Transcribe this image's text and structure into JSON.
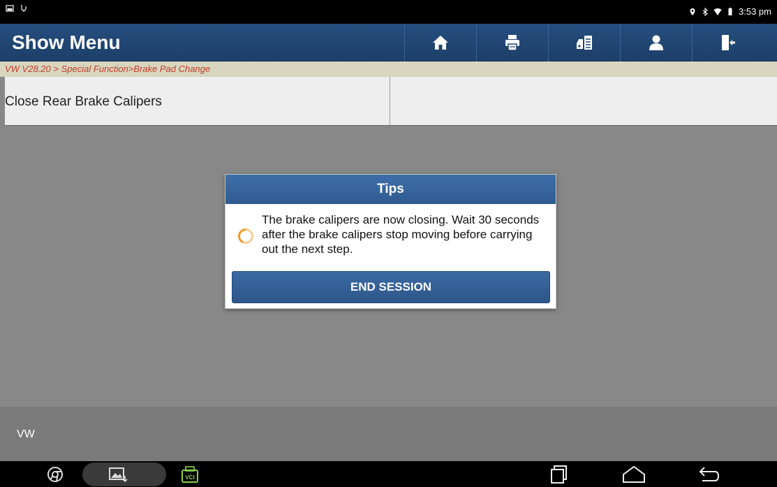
{
  "status_bar": {
    "time": "3:53 pm"
  },
  "header": {
    "title": "Show Menu",
    "toolbar": [
      {
        "icon": "home-icon"
      },
      {
        "icon": "print-icon"
      },
      {
        "icon": "vehicle-info-icon"
      },
      {
        "icon": "user-icon"
      },
      {
        "icon": "exit-icon"
      }
    ]
  },
  "breadcrumb": "VW V28.20 > Special Function>Brake Pad Change",
  "menu": {
    "rows": [
      {
        "label": "Close Rear Brake Calipers",
        "value": ""
      }
    ]
  },
  "footer": {
    "label": "VW"
  },
  "dialog": {
    "title": "Tips",
    "message": "The brake calipers are now closing. Wait 30 seconds after the brake calipers stop moving before carrying out the next step.",
    "button_label": "END SESSION"
  },
  "navbar": {
    "vci_label": "VCI"
  },
  "colors": {
    "header_bg": "#1f4270",
    "breadcrumb_text": "#c23b2a",
    "dialog_title_bg": "#3565a0",
    "spinner": "#f0a030"
  }
}
